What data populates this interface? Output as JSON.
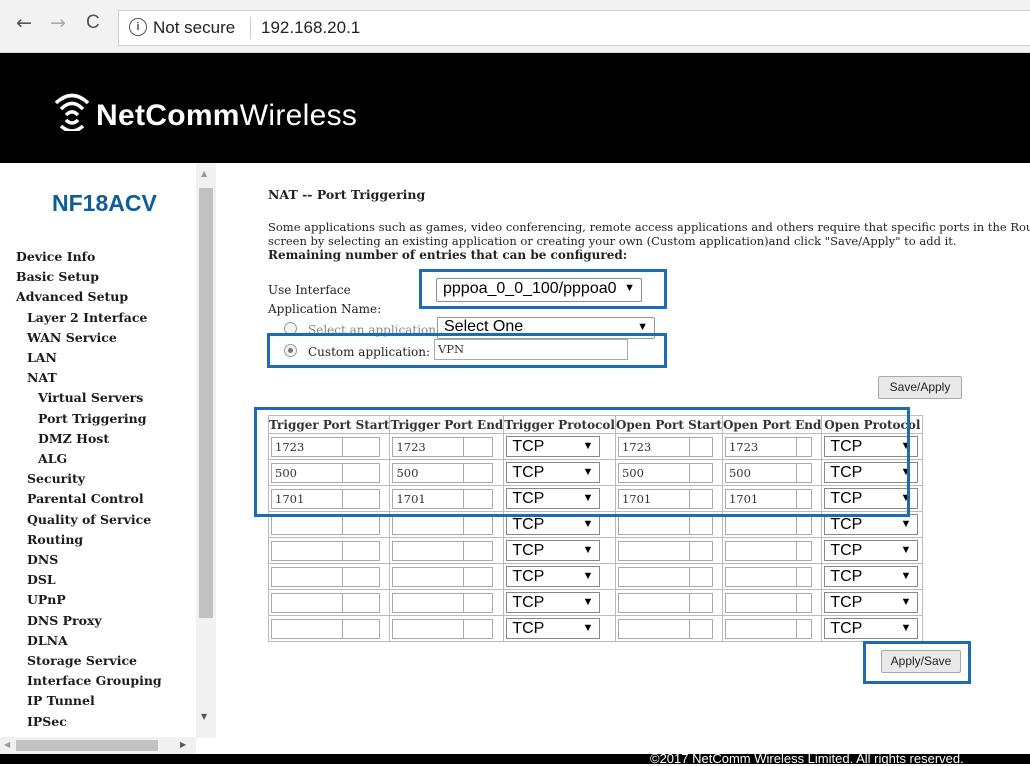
{
  "browser": {
    "back": "←",
    "forward": "→",
    "reload": "C",
    "security_label": "Not secure",
    "url": "192.168.20.1"
  },
  "header": {
    "brand_bold": "NetComm",
    "brand_light": "Wireless"
  },
  "sidebar": {
    "model": "NF18ACV",
    "items": [
      {
        "label": "Device Info",
        "level": 0
      },
      {
        "label": "Basic Setup",
        "level": 0
      },
      {
        "label": "Advanced Setup",
        "level": 0
      },
      {
        "label": "Layer 2 Interface",
        "level": 1
      },
      {
        "label": "WAN Service",
        "level": 1
      },
      {
        "label": "LAN",
        "level": 1
      },
      {
        "label": "NAT",
        "level": 1
      },
      {
        "label": "Virtual Servers",
        "level": 2
      },
      {
        "label": "Port Triggering",
        "level": 2
      },
      {
        "label": "DMZ Host",
        "level": 2
      },
      {
        "label": "ALG",
        "level": 2
      },
      {
        "label": "Security",
        "level": 1
      },
      {
        "label": "Parental Control",
        "level": 1
      },
      {
        "label": "Quality of Service",
        "level": 1
      },
      {
        "label": "Routing",
        "level": 1
      },
      {
        "label": "DNS",
        "level": 1
      },
      {
        "label": "DSL",
        "level": 1
      },
      {
        "label": "UPnP",
        "level": 1
      },
      {
        "label": "DNS Proxy",
        "level": 1
      },
      {
        "label": "DLNA",
        "level": 1
      },
      {
        "label": "Storage Service",
        "level": 1
      },
      {
        "label": "Interface Grouping",
        "level": 1
      },
      {
        "label": "IP Tunnel",
        "level": 1
      },
      {
        "label": "IPSec",
        "level": 1
      }
    ]
  },
  "main": {
    "title": "NAT -- Port Triggering",
    "description_line1": "Some applications such as games, video conferencing, remote access applications and others require that specific ports in the Router's fir",
    "description_line2": "screen by selecting an existing application or creating your own (Custom application)and click \"Save/Apply\" to add it.",
    "remaining_label": "Remaining number of entries that can be configured:",
    "use_interface_label": "Use Interface",
    "interface_value": "pppoa_0_0_100/pppoa0",
    "app_name_label": "Application Name:",
    "select_app_label": "Select an application:",
    "select_app_value": "Select One",
    "custom_app_label": "Custom application:",
    "custom_app_value": "VPN",
    "save_apply_label": "Save/Apply",
    "apply_save_label": "Apply/Save",
    "columns": [
      "Trigger Port Start",
      "Trigger Port End",
      "Trigger Protocol",
      "Open Port Start",
      "Open Port End",
      "Open Protocol"
    ],
    "rows": [
      {
        "trigger_start": "1723",
        "trigger_end": "1723",
        "trigger_protocol": "TCP",
        "open_start": "1723",
        "open_end": "1723",
        "open_protocol": "TCP"
      },
      {
        "trigger_start": "500",
        "trigger_end": "500",
        "trigger_protocol": "TCP",
        "open_start": "500",
        "open_end": "500",
        "open_protocol": "TCP"
      },
      {
        "trigger_start": "1701",
        "trigger_end": "1701",
        "trigger_protocol": "TCP",
        "open_start": "1701",
        "open_end": "1701",
        "open_protocol": "TCP"
      },
      {
        "trigger_start": "",
        "trigger_end": "",
        "trigger_protocol": "TCP",
        "open_start": "",
        "open_end": "",
        "open_protocol": "TCP"
      },
      {
        "trigger_start": "",
        "trigger_end": "",
        "trigger_protocol": "TCP",
        "open_start": "",
        "open_end": "",
        "open_protocol": "TCP"
      },
      {
        "trigger_start": "",
        "trigger_end": "",
        "trigger_protocol": "TCP",
        "open_start": "",
        "open_end": "",
        "open_protocol": "TCP"
      },
      {
        "trigger_start": "",
        "trigger_end": "",
        "trigger_protocol": "TCP",
        "open_start": "",
        "open_end": "",
        "open_protocol": "TCP"
      },
      {
        "trigger_start": "",
        "trigger_end": "",
        "trigger_protocol": "TCP",
        "open_start": "",
        "open_end": "",
        "open_protocol": "TCP"
      }
    ]
  },
  "footer": "©2017 NetComm Wireless Limited. All rights reserved.",
  "colors": {
    "header_bg": "#000000",
    "model_text": "#0c5f9a",
    "highlight": "#1d6bb3"
  }
}
